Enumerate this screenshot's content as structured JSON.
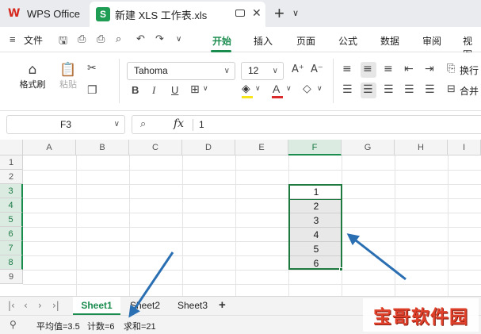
{
  "titlebar": {
    "app_tab": "WPS Office",
    "doc_tab": "新建 XLS 工作表.xls",
    "doc_icon_letter": "S",
    "close": "✕",
    "new_tab": "+",
    "more": "∨"
  },
  "menubar": {
    "hamburger": "≡",
    "file": "文件",
    "items": [
      "开始",
      "插入",
      "页面",
      "公式",
      "数据",
      "审阅",
      "视图"
    ],
    "active_index": 0
  },
  "ribbon": {
    "format_painter": "格式刷",
    "paste": "粘贴",
    "font_name": "Tahoma",
    "font_size": "12",
    "bold": "B",
    "italic": "I",
    "underline": "U",
    "wrap": "换行",
    "merge": "合并"
  },
  "formula_bar": {
    "cell_ref": "F3",
    "fx": "fx",
    "value": "1"
  },
  "grid": {
    "columns": [
      "A",
      "B",
      "C",
      "D",
      "E",
      "F",
      "G",
      "H",
      "I"
    ],
    "selected_column": "F",
    "rows": [
      "1",
      "2",
      "3",
      "4",
      "5",
      "6",
      "7",
      "8",
      "9"
    ],
    "selected_rows": [
      "3",
      "4",
      "5",
      "6",
      "7",
      "8"
    ],
    "f_values": [
      "1",
      "2",
      "3",
      "4",
      "5",
      "6"
    ]
  },
  "sheets": {
    "tabs": [
      "Sheet1",
      "Sheet2",
      "Sheet3"
    ],
    "active_index": 0,
    "add": "+"
  },
  "status": {
    "average": "平均值=3.5",
    "count": "计数=6",
    "sum": "求和=21"
  },
  "watermark": "宝哥软件园",
  "colors": {
    "accent": "#1a8c4e",
    "selection_border": "#1e7a3f",
    "arrow": "#2b6fb3"
  }
}
